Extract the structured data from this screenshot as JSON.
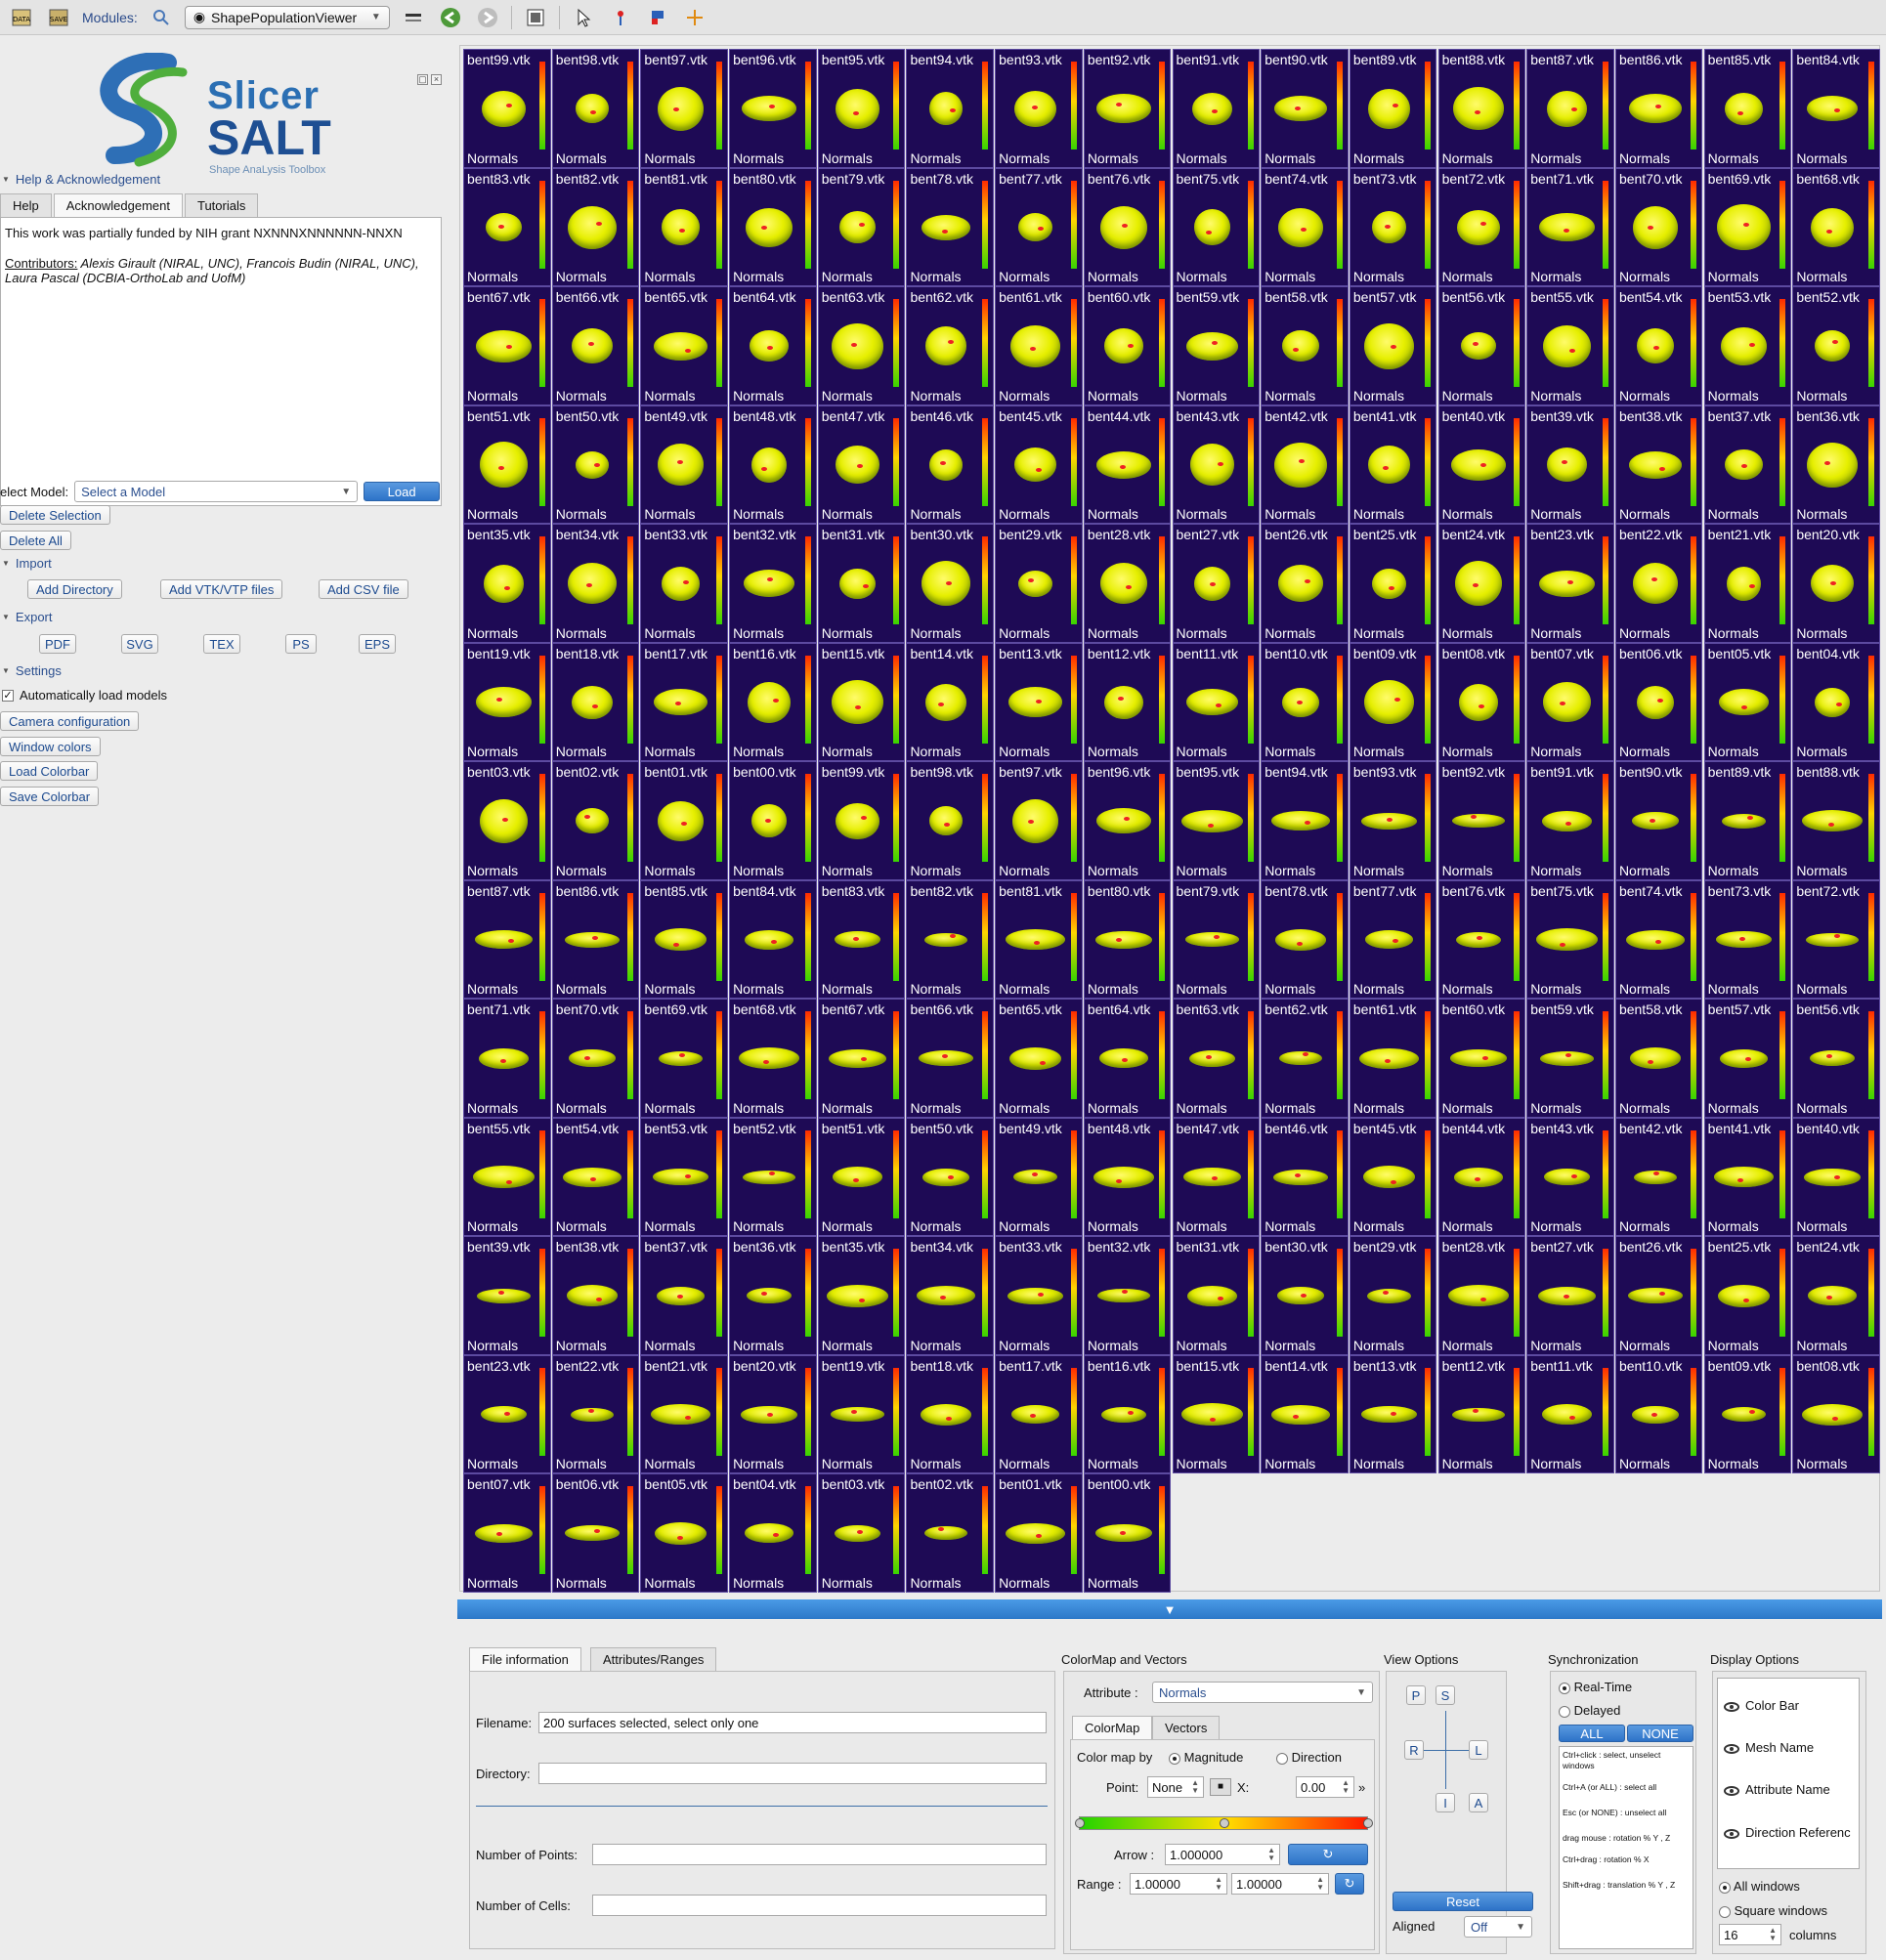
{
  "toolbar": {
    "data_label": "DATA",
    "save_label": "SAVE",
    "modules_label": "Modules:",
    "module_selected": "ShapePopulationViewer"
  },
  "left": {
    "logo": {
      "line1": "Slicer",
      "line2": "SALT",
      "line3": "Shape AnaLysis Toolbox"
    },
    "help_section": "Help & Acknowledgement",
    "tabs": [
      "Help",
      "Acknowledgement",
      "Tutorials"
    ],
    "ack_text": "This work was partially funded by NIH grant NXNNNXNNNNNN-NNXN",
    "contrib_label": "Contributors:",
    "contrib_text": " Alexis Girault (NIRAL, UNC), Francois Budin (NIRAL, UNC), Laura Pascal (DCBIA-OrthoLab and UofM)",
    "select_model_label": "elect Model:",
    "select_model_value": "Select a Model",
    "load_label": "Load",
    "delete_selection": "Delete Selection",
    "delete_all": "Delete All",
    "import_section": "Import",
    "add_directory": "Add Directory",
    "add_vtk": "Add VTK/VTP files",
    "add_csv": "Add CSV file",
    "export_section": "Export",
    "export_buttons": [
      "PDF",
      "SVG",
      "TEX",
      "PS",
      "EPS"
    ],
    "settings_section": "Settings",
    "auto_load": "Automatically load models",
    "camera_config": "Camera configuration",
    "window_colors": "Window colors",
    "load_colorbar": "Load Colorbar",
    "save_colorbar": "Save Colorbar"
  },
  "grid": {
    "attribute_label": "Normals",
    "models": [
      "bent99.vtk",
      "bent98.vtk",
      "bent97.vtk",
      "bent96.vtk",
      "bent95.vtk",
      "bent94.vtk",
      "bent93.vtk",
      "bent92.vtk",
      "bent91.vtk",
      "bent90.vtk",
      "bent89.vtk",
      "bent88.vtk",
      "bent87.vtk",
      "bent86.vtk",
      "bent85.vtk",
      "bent84.vtk",
      "bent83.vtk",
      "bent82.vtk",
      "bent81.vtk",
      "bent80.vtk",
      "bent79.vtk",
      "bent78.vtk",
      "bent77.vtk",
      "bent76.vtk",
      "bent75.vtk",
      "bent74.vtk",
      "bent73.vtk",
      "bent72.vtk",
      "bent71.vtk",
      "bent70.vtk",
      "bent69.vtk",
      "bent68.vtk",
      "bent67.vtk",
      "bent66.vtk",
      "bent65.vtk",
      "bent64.vtk",
      "bent63.vtk",
      "bent62.vtk",
      "bent61.vtk",
      "bent60.vtk",
      "bent59.vtk",
      "bent58.vtk",
      "bent57.vtk",
      "bent56.vtk",
      "bent55.vtk",
      "bent54.vtk",
      "bent53.vtk",
      "bent52.vtk",
      "bent51.vtk",
      "bent50.vtk",
      "bent49.vtk",
      "bent48.vtk",
      "bent47.vtk",
      "bent46.vtk",
      "bent45.vtk",
      "bent44.vtk",
      "bent43.vtk",
      "bent42.vtk",
      "bent41.vtk",
      "bent40.vtk",
      "bent39.vtk",
      "bent38.vtk",
      "bent37.vtk",
      "bent36.vtk",
      "bent35.vtk",
      "bent34.vtk",
      "bent33.vtk",
      "bent32.vtk",
      "bent31.vtk",
      "bent30.vtk",
      "bent29.vtk",
      "bent28.vtk",
      "bent27.vtk",
      "bent26.vtk",
      "bent25.vtk",
      "bent24.vtk",
      "bent23.vtk",
      "bent22.vtk",
      "bent21.vtk",
      "bent20.vtk",
      "bent19.vtk",
      "bent18.vtk",
      "bent17.vtk",
      "bent16.vtk",
      "bent15.vtk",
      "bent14.vtk",
      "bent13.vtk",
      "bent12.vtk",
      "bent11.vtk",
      "bent10.vtk",
      "bent09.vtk",
      "bent08.vtk",
      "bent07.vtk",
      "bent06.vtk",
      "bent05.vtk",
      "bent04.vtk",
      "bent03.vtk",
      "bent02.vtk",
      "bent01.vtk",
      "bent00.vtk",
      "bent99.vtk",
      "bent98.vtk",
      "bent97.vtk",
      "bent96.vtk",
      "bent95.vtk",
      "bent94.vtk",
      "bent93.vtk",
      "bent92.vtk",
      "bent91.vtk",
      "bent90.vtk",
      "bent89.vtk",
      "bent88.vtk",
      "bent87.vtk",
      "bent86.vtk",
      "bent85.vtk",
      "bent84.vtk",
      "bent83.vtk",
      "bent82.vtk",
      "bent81.vtk",
      "bent80.vtk",
      "bent79.vtk",
      "bent78.vtk",
      "bent77.vtk",
      "bent76.vtk",
      "bent75.vtk",
      "bent74.vtk",
      "bent73.vtk",
      "bent72.vtk",
      "bent71.vtk",
      "bent70.vtk",
      "bent69.vtk",
      "bent68.vtk",
      "bent67.vtk",
      "bent66.vtk",
      "bent65.vtk",
      "bent64.vtk",
      "bent63.vtk",
      "bent62.vtk",
      "bent61.vtk",
      "bent60.vtk",
      "bent59.vtk",
      "bent58.vtk",
      "bent57.vtk",
      "bent56.vtk",
      "bent55.vtk",
      "bent54.vtk",
      "bent53.vtk",
      "bent52.vtk",
      "bent51.vtk",
      "bent50.vtk",
      "bent49.vtk",
      "bent48.vtk",
      "bent47.vtk",
      "bent46.vtk",
      "bent45.vtk",
      "bent44.vtk",
      "bent43.vtk",
      "bent42.vtk",
      "bent41.vtk",
      "bent40.vtk",
      "bent39.vtk",
      "bent38.vtk",
      "bent37.vtk",
      "bent36.vtk",
      "bent35.vtk",
      "bent34.vtk",
      "bent33.vtk",
      "bent32.vtk",
      "bent31.vtk",
      "bent30.vtk",
      "bent29.vtk",
      "bent28.vtk",
      "bent27.vtk",
      "bent26.vtk",
      "bent25.vtk",
      "bent24.vtk",
      "bent23.vtk",
      "bent22.vtk",
      "bent21.vtk",
      "bent20.vtk",
      "bent19.vtk",
      "bent18.vtk",
      "bent17.vtk",
      "bent16.vtk",
      "bent15.vtk",
      "bent14.vtk",
      "bent13.vtk",
      "bent12.vtk",
      "bent11.vtk",
      "bent10.vtk",
      "bent09.vtk",
      "bent08.vtk",
      "bent07.vtk",
      "bent06.vtk",
      "bent05.vtk",
      "bent04.vtk",
      "bent03.vtk",
      "bent02.vtk",
      "bent01.vtk",
      "bent00.vtk"
    ]
  },
  "bottom": {
    "tabs": [
      "File information",
      "Attributes/Ranges"
    ],
    "filename_label": "Filename:",
    "filename_value": "200 surfaces selected, select only one",
    "directory_label": "Directory:",
    "points_label": "Number of Points:",
    "cells_label": "Number of Cells:",
    "colormap_title": "ColorMap and Vectors",
    "attribute_label": "Attribute :",
    "attribute_value": "Normals",
    "cm_tabs": [
      "ColorMap",
      "Vectors"
    ],
    "color_map_by": "Color map by",
    "magnitude": "Magnitude",
    "direction": "Direction",
    "point_label": "Point:",
    "point_value": "None",
    "x_label": "X:",
    "x_value": "0.00",
    "arrow_label": "Arrow :",
    "arrow_value": "1.000000",
    "range_label": "Range :",
    "range_min": "1.00000",
    "range_max": "1.00000",
    "view_title": "View Options",
    "view_letters": [
      "P",
      "S",
      "R",
      "L",
      "I",
      "A"
    ],
    "reset_label": "Reset",
    "aligned_label": "Aligned",
    "aligned_value": "Off",
    "sync_title": "Synchronization",
    "realtime": "Real-Time",
    "delayed": "Delayed",
    "all_label": "ALL",
    "none_label": "NONE",
    "sync_help": [
      "Ctrl+click : select, unselect windows",
      "Ctrl+A (or ALL) : select all",
      "Esc (or NONE) : unselect all",
      "drag mouse : rotation % Y , Z",
      "Ctrl+drag : rotation % X",
      "Shift+drag : translation % Y , Z"
    ],
    "display_title": "Display Options",
    "display_items": [
      "Color Bar",
      "Mesh Name",
      "Attribute Name",
      "Direction Referenc"
    ],
    "all_windows": "All windows",
    "square_windows": "Square windows",
    "columns_value": "16",
    "columns_label": "columns"
  }
}
